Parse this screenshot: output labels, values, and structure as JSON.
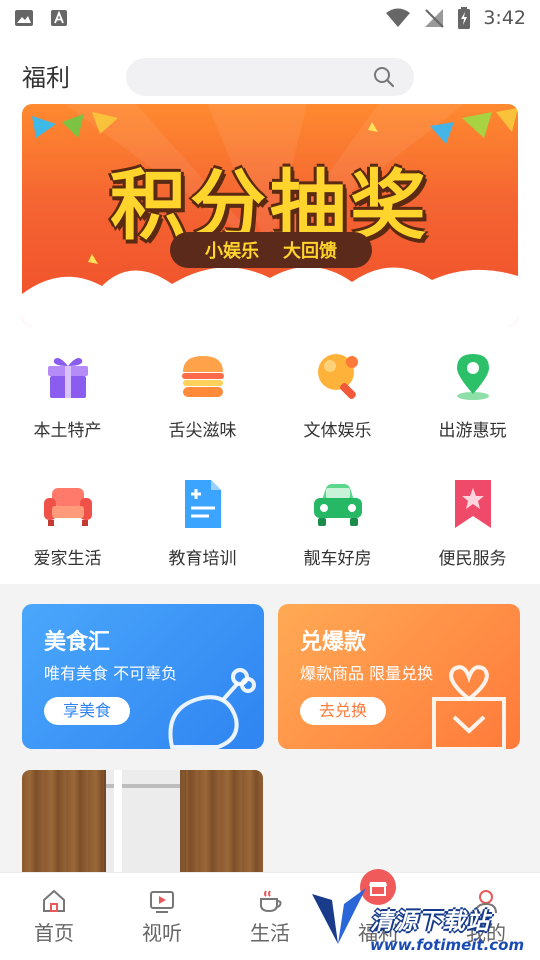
{
  "status_bar": {
    "time": "3:42"
  },
  "header": {
    "title": "福利"
  },
  "banner": {
    "headline": "积分抽奖",
    "tag_left": "小娱乐",
    "tag_right": "大回馈"
  },
  "categories": [
    {
      "label": "本土特产",
      "icon": "gift-icon"
    },
    {
      "label": "舌尖滋味",
      "icon": "burger-icon"
    },
    {
      "label": "文体娱乐",
      "icon": "ping-pong-icon"
    },
    {
      "label": "出游惠玩",
      "icon": "location-pin-icon"
    },
    {
      "label": "爱家生活",
      "icon": "sofa-icon"
    },
    {
      "label": "教育培训",
      "icon": "document-icon"
    },
    {
      "label": "靓车好房",
      "icon": "car-icon"
    },
    {
      "label": "便民服务",
      "icon": "bookmark-star-icon"
    }
  ],
  "promos": [
    {
      "title": "美食汇",
      "subtitle": "唯有美食 不可辜负",
      "button": "享美食",
      "color": "#3b8ff5"
    },
    {
      "title": "兑爆款",
      "subtitle": "爆款商品 限量兑换",
      "button": "去兑换",
      "color": "#ff8844"
    }
  ],
  "bottom_nav": [
    {
      "label": "首页",
      "icon": "home-icon"
    },
    {
      "label": "视听",
      "icon": "video-icon"
    },
    {
      "label": "生活",
      "icon": "coffee-icon"
    },
    {
      "label": "福利",
      "icon": "store-icon",
      "active": true
    },
    {
      "label": "我的",
      "icon": "profile-icon"
    }
  ],
  "watermark": {
    "text": "清源下载站",
    "url": "www.fotimeit.com"
  },
  "colors": {
    "accent_red": "#f05a5a",
    "banner_orange": "#f46432",
    "headline_yellow": "#ffd42c"
  }
}
